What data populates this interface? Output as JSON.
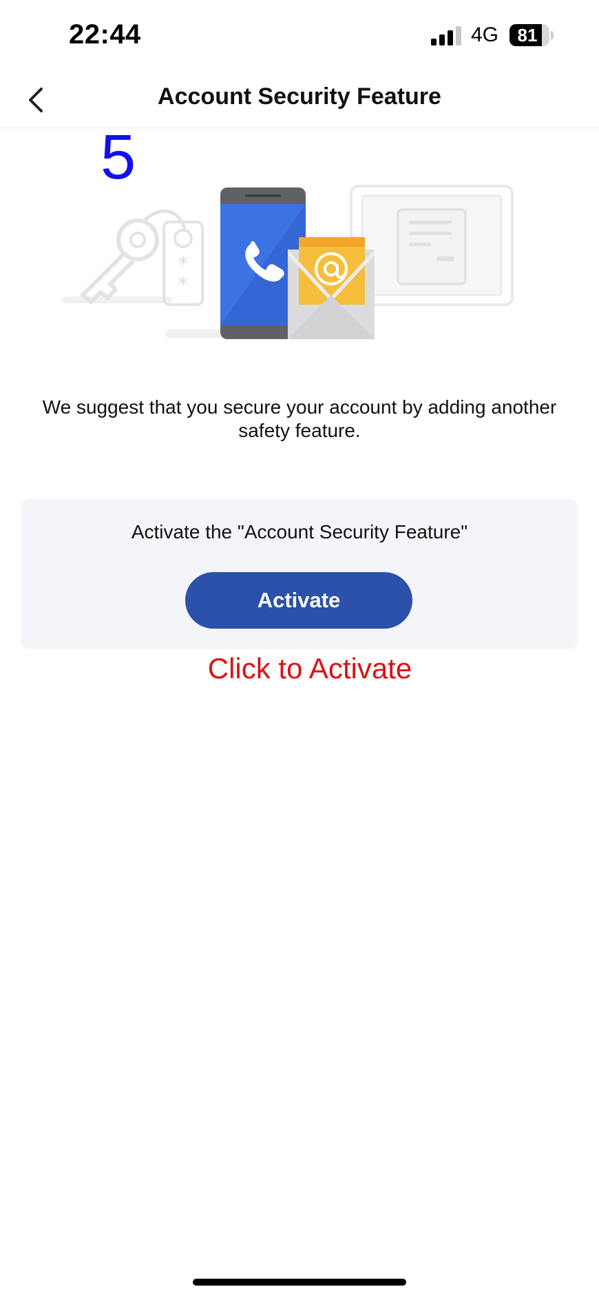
{
  "status_bar": {
    "time": "22:44",
    "network": "4G",
    "battery": "81",
    "battery_level": 0.81
  },
  "nav": {
    "title": "Account Security Feature"
  },
  "step_annotation": "5",
  "illustration": {
    "icons": [
      "key-icon",
      "phone-icon",
      "email-at-icon",
      "document-icon"
    ]
  },
  "main": {
    "suggestion": "We suggest that you secure your account by adding another safety feature."
  },
  "card": {
    "text": "Activate the \"Account Security Feature\"",
    "button_label": "Activate"
  },
  "hint": "Click to Activate",
  "colors": {
    "primary_button": "#2b51ab",
    "card_background": "#f3f5f9",
    "hint_red": "#dd1111",
    "annotation_blue": "#1010f0"
  }
}
